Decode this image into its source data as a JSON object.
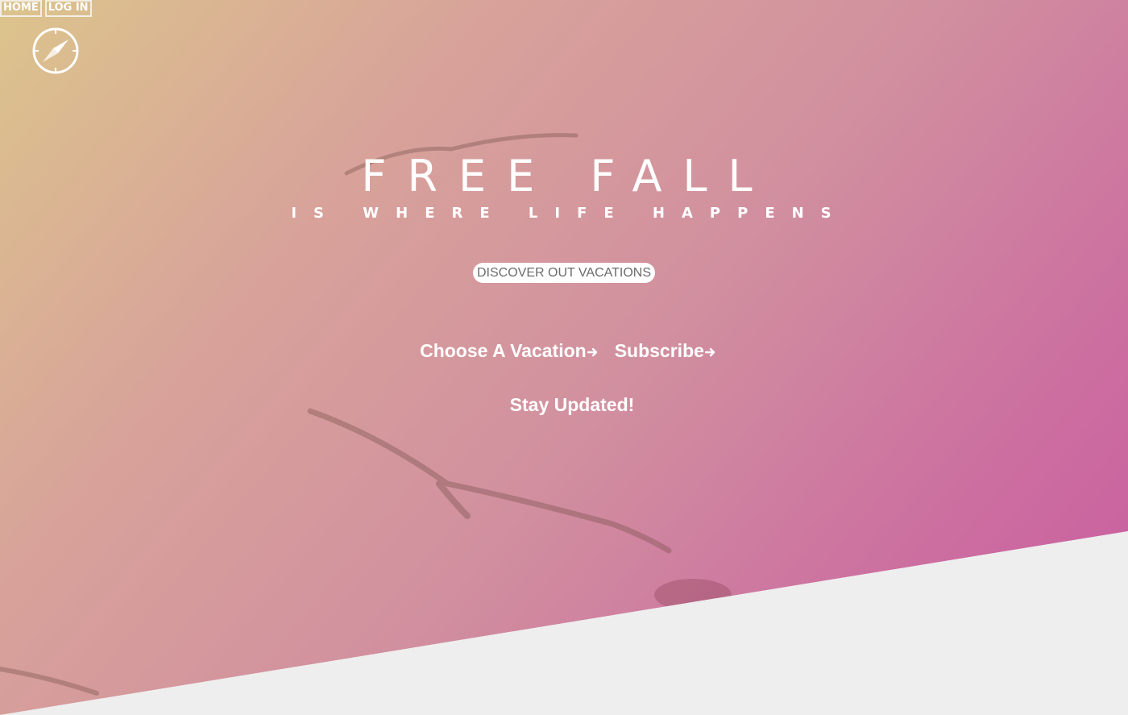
{
  "nav": {
    "home_label": "HOME",
    "login_label": "LOG IN"
  },
  "logo": {
    "icon": "compass-icon"
  },
  "hero": {
    "title": "FREE FALL",
    "subtitle": "IS WHERE LIFE HAPPENS",
    "cta_label": "DISCOVER OUT VACATIONS",
    "links": [
      {
        "label": "Choose A Vacation",
        "icon": "arrow-right-icon"
      },
      {
        "label": "Subscribe",
        "icon": "arrow-right-icon"
      }
    ],
    "stay_label": "Stay Updated!"
  },
  "colors": {
    "gradient_start": "#dcc48c",
    "gradient_mid": "#d18f9f",
    "gradient_end": "#c95b9f",
    "bottom_band": "#eeeeee",
    "text": "#ffffff",
    "cta_text": "#6b6b6b"
  }
}
